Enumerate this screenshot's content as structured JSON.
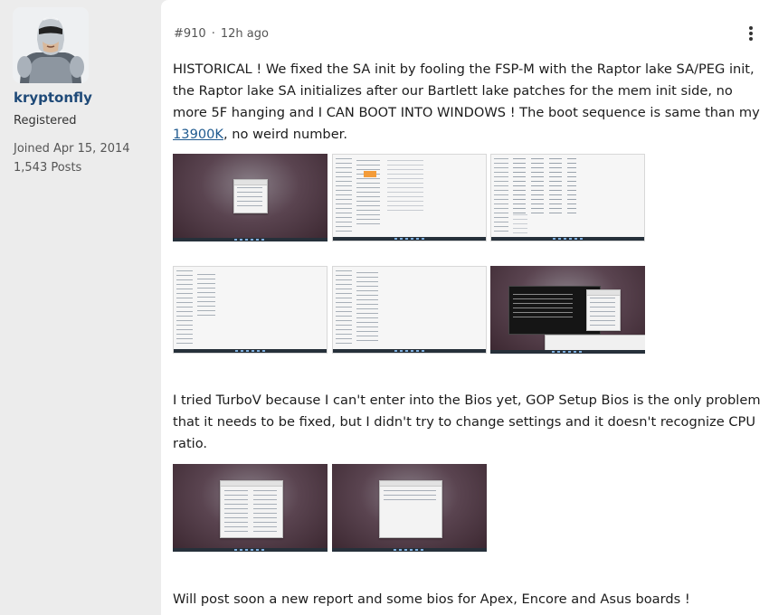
{
  "user": {
    "name": "kryptonfly",
    "role": "Registered",
    "joined": "Joined Apr 15, 2014",
    "posts": "1,543 Posts"
  },
  "post": {
    "number": "#910",
    "separator": "·",
    "time": "12h ago",
    "paragraph1_before": "HISTORICAL ! We fixed the SA init by fooling the FSP-M with the Raptor lake SA/PEG init, the Raptor lake SA initializes after our Bartlett lake patches for the mem init side, no more 5F hanging and I CAN BOOT INTO WINDOWS ! The boot sequence is same than my ",
    "paragraph1_link": "13900K",
    "paragraph1_after": ", no weird number.",
    "paragraph2": "I tried TurboV because I can't enter into the Bios yet, GOP Setup Bios is the only problem that it needs to be fixed, but I didn't try to change settings and it doesn't recognize CPU ratio.",
    "paragraph3": "Will post soon a new report and some bios for Apex, Encore and Asus boards !"
  },
  "icons": {
    "more": "more-vertical-icon",
    "avatar": "robocop-avatar"
  },
  "colors": {
    "username": "#1f4a78",
    "link": "#1f5a8f",
    "page_bg": "#ececec",
    "post_bg": "#ffffff"
  }
}
